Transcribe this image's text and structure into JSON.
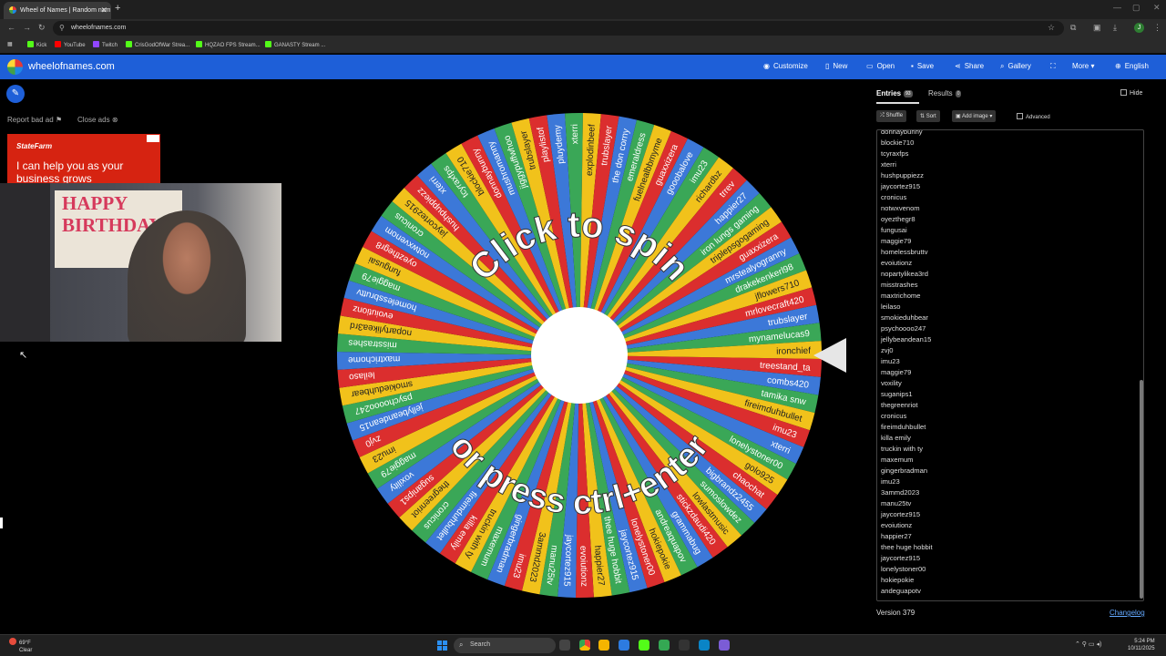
{
  "browser": {
    "tab_title": "Wheel of Names | Random nam",
    "url": "wheelofnames.com",
    "bookmarks": [
      {
        "label": "Kick",
        "color": "#53fc18"
      },
      {
        "label": "YouTube",
        "color": "#ff0000"
      },
      {
        "label": "Twitch",
        "color": "#9146ff"
      },
      {
        "label": "CrisGodOfWar Strea...",
        "color": "#53fc18"
      },
      {
        "label": "HQZAO FPS Stream...",
        "color": "#53fc18"
      },
      {
        "label": "GANASTY Stream ...",
        "color": "#53fc18"
      }
    ],
    "profile_initial": "J"
  },
  "header": {
    "site_name": "wheelofnames.com",
    "buttons": {
      "customize": "Customize",
      "new": "New",
      "open": "Open",
      "save": "Save",
      "share": "Share",
      "gallery": "Gallery",
      "more": "More",
      "language": "English"
    },
    "color": "#1e5fd8"
  },
  "ad": {
    "report": "Report bad ad",
    "close": "Close ads",
    "brand": "StateFarm",
    "copy": "I can help you as your business grows"
  },
  "webcam": {
    "banner_text": "HAPPY BIRTHDAY"
  },
  "wheel": {
    "center_text_top": "Click to spin",
    "center_text_bottom": "or press ctrl+enter",
    "colors": [
      "#db2e2e",
      "#3c78d8",
      "#3aa757",
      "#f1c21b"
    ],
    "segments": [
      "treestand_ta",
      "combs420",
      "tamika snw",
      "fireimduhbullet",
      "imu23",
      "xterri",
      "lonelystoner00",
      "golo925",
      "chaochat",
      "bigbrandz2455",
      "sumoslowdez",
      "lowlastmusic",
      "stickzdaudi420",
      "grammabug",
      "andreaquapov",
      "hokiepokie",
      "lonelystoner00",
      "jaycortez915",
      "thee huge hobbit",
      "happier27",
      "evoiutionz",
      "jaycortez915",
      "manu25tv",
      "3ammd2023",
      "imu23",
      "gingerbradman",
      "maxemum",
      "truckin with ty",
      "killa emily",
      "fireimduhbullet",
      "cronicus",
      "thegreenriot",
      "suganips1",
      "voxility",
      "maggie79",
      "imu23",
      "zvj0",
      "jellybeandean15",
      "psychoooo247",
      "smokieduhbear",
      "leilaso",
      "maxtrichome",
      "misstrashes",
      "nopartylikea3rd",
      "evoiutionz",
      "homelessbruttv",
      "maggie79",
      "fungusai",
      "oyezthegr8",
      "notwxvenom",
      "cronicus",
      "jaycortez915",
      "hushpuppiezz",
      "xterri",
      "tcyraxfps",
      "blockie710",
      "donnaybunny",
      "mushromanny",
      "jiggypuffwhoo",
      "trubslayer",
      "playlistof",
      "pluydemy",
      "xterri",
      "explodinbeef",
      "trubslayer",
      "the don corny",
      "emeraldress",
      "fuelnealbbmyme",
      "guaxxizera",
      "gooobalove",
      "imu23",
      "richardbz",
      "trrev",
      "happier27",
      "iron lungs gaming",
      "triplepsgogaming",
      "guaxxizera",
      "mrstealyogranny",
      "drakekenkerl98",
      "jflowers710",
      "mrlovecraft420",
      "trubslayer",
      "mynamelucas9",
      "ironchief"
    ]
  },
  "panel": {
    "tab_entries": "Entries",
    "entries_count": "93",
    "tab_results": "Results",
    "results_count": "0",
    "hide": "Hide",
    "shuffle": "Shuffle",
    "sort": "Sort",
    "add_image": "Add image",
    "advanced": "Advanced",
    "entries": [
      "donnaybunny",
      "blockie710",
      "tcyraxfps",
      "xterri",
      "hushpuppiezz",
      "jaycortez915",
      "cronicus",
      "notwxvenom",
      "oyezthegr8",
      "fungusai",
      "maggie79",
      "homelessbruttv",
      "evoiutionz",
      "nopartylikea3rd",
      "misstrashes",
      "maxtrichome",
      "leilaso",
      "smokieduhbear",
      "psychoooo247",
      "jellybeandean15",
      "zvj0",
      "imu23",
      "maggie79",
      "voxility",
      "suganips1",
      "thegreenriot",
      "cronicus",
      "fireimduhbullet",
      "killa emily",
      "truckin with ty",
      "maxemum",
      "gingerbradman",
      "imu23",
      "3ammd2023",
      "manu25tv",
      "jaycortez915",
      "evoiutionz",
      "happier27",
      "thee huge hobbit",
      "jaycortez915",
      "lonelystoner00",
      "hokiepokie",
      "andeguapotv"
    ],
    "version": "Version 379",
    "changelog": "Changelog"
  },
  "taskbar": {
    "weather_temp": "69°F",
    "weather_desc": "Clear",
    "search": "Search",
    "time": "5:24 PM",
    "date": "10/11/2025"
  }
}
